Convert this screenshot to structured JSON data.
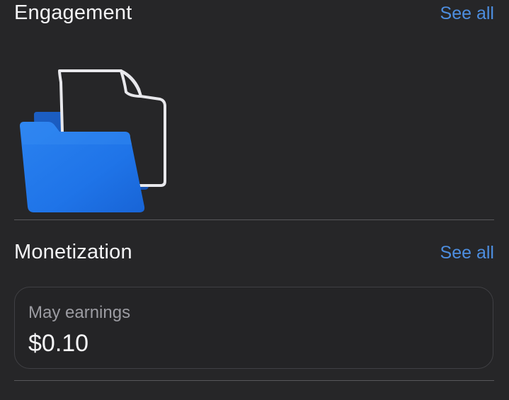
{
  "engagement": {
    "title": "Engagement",
    "see_all": "See all",
    "illustration_icon": "folder-with-document-icon"
  },
  "monetization": {
    "title": "Monetization",
    "see_all": "See all",
    "earnings_card": {
      "label": "May earnings",
      "value": "$0.10"
    }
  },
  "colors": {
    "background": "#262628",
    "accent_link": "#4d8ee0",
    "folder_blue": "#1f74e8"
  }
}
